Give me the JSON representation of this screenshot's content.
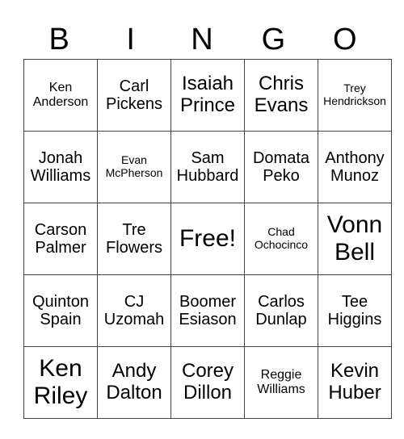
{
  "header": [
    "B",
    "I",
    "N",
    "G",
    "O"
  ],
  "rows": [
    [
      {
        "text": "Ken Anderson",
        "size": "s2"
      },
      {
        "text": "Carl Pickens",
        "size": "s3"
      },
      {
        "text": "Isaiah Prince",
        "size": "s4"
      },
      {
        "text": "Chris Evans",
        "size": "s4"
      },
      {
        "text": "Trey Hendrickson",
        "size": "s1"
      }
    ],
    [
      {
        "text": "Jonah Williams",
        "size": "s3"
      },
      {
        "text": "Evan McPherson",
        "size": "s1"
      },
      {
        "text": "Sam Hubbard",
        "size": "s3"
      },
      {
        "text": "Domata Peko",
        "size": "s3"
      },
      {
        "text": "Anthony Munoz",
        "size": "s3"
      }
    ],
    [
      {
        "text": "Carson Palmer",
        "size": "s3"
      },
      {
        "text": "Tre Flowers",
        "size": "s3"
      },
      {
        "text": "Free!",
        "size": "s5"
      },
      {
        "text": "Chad Ochocinco",
        "size": "s1"
      },
      {
        "text": "Vonn Bell",
        "size": "s5"
      }
    ],
    [
      {
        "text": "Quinton Spain",
        "size": "s3"
      },
      {
        "text": "CJ Uzomah",
        "size": "s3"
      },
      {
        "text": "Boomer Esiason",
        "size": "s3"
      },
      {
        "text": "Carlos Dunlap",
        "size": "s3"
      },
      {
        "text": "Tee Higgins",
        "size": "s3"
      }
    ],
    [
      {
        "text": "Ken Riley",
        "size": "s5"
      },
      {
        "text": "Andy Dalton",
        "size": "s4"
      },
      {
        "text": "Corey Dillon",
        "size": "s4"
      },
      {
        "text": "Reggie Williams",
        "size": "s2"
      },
      {
        "text": "Kevin Huber",
        "size": "s4"
      }
    ]
  ]
}
